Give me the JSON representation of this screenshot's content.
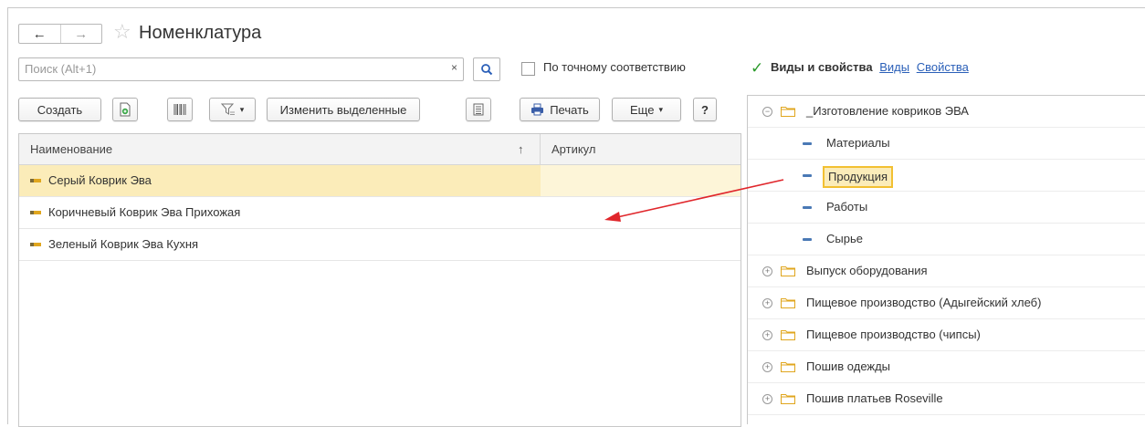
{
  "window": {
    "title": "Номенклатура",
    "back_label": "←",
    "forward_label": "→",
    "star": "☆"
  },
  "search": {
    "placeholder": "Поиск (Alt+1)",
    "clear": "×",
    "exact_match_label": "По точному соответствию"
  },
  "toolbar": {
    "create_label": "Создать",
    "edit_selected_label": "Изменить выделенные",
    "print_label": "Печать",
    "more_label": "Еще",
    "help_label": "?"
  },
  "table": {
    "columns": [
      "Наименование",
      "Артикул"
    ],
    "sort_indicator": "↑",
    "rows": [
      {
        "name": "Серый Коврик Эва",
        "article": "",
        "selected": true
      },
      {
        "name": "Коричневый Коврик Эва Прихожая",
        "article": ""
      },
      {
        "name": "Зеленый Коврик Эва Кухня",
        "article": ""
      }
    ]
  },
  "right_panel": {
    "title": "Виды и свойства",
    "link_kinds": "Виды",
    "link_props": "Свойства",
    "tree": [
      {
        "label": "_Изготовление ковриков ЭВА",
        "type": "folder",
        "expanded": true
      },
      {
        "label": "Материалы",
        "type": "item"
      },
      {
        "label": "Продукция",
        "type": "item",
        "highlighted": true
      },
      {
        "label": "Работы",
        "type": "item"
      },
      {
        "label": "Сырье",
        "type": "item"
      },
      {
        "label": "Выпуск оборудования",
        "type": "folder"
      },
      {
        "label": "Пищевое производство (Адыгейский хлеб)",
        "type": "folder"
      },
      {
        "label": "Пищевое производство (чипсы)",
        "type": "folder"
      },
      {
        "label": "Пошив одежды",
        "type": "folder"
      },
      {
        "label": "Пошив платьев Roseville",
        "type": "folder"
      }
    ]
  },
  "colors": {
    "selection": "#fbecb9",
    "highlight_border": "#f2c032",
    "link": "#2a5fb8",
    "annotation_arrow": "#e0262b",
    "folder": "#f0c24a"
  }
}
